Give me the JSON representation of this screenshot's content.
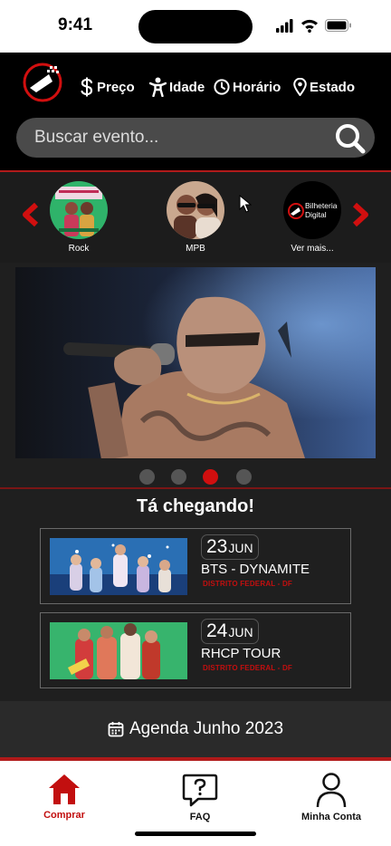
{
  "status_bar": {
    "time": "9:41"
  },
  "filters": [
    {
      "label": "Preço",
      "icon": "dollar-icon"
    },
    {
      "label": "Idade",
      "icon": "person-icon"
    },
    {
      "label": "Horário",
      "icon": "clock-icon"
    },
    {
      "label": "Estado",
      "icon": "location-pin-icon"
    }
  ],
  "search": {
    "placeholder": "Buscar evento..."
  },
  "categories": [
    {
      "label": "Rock"
    },
    {
      "label": "MPB"
    },
    {
      "label": "Ver mais...",
      "logo_text": "Bilheteria Digital"
    }
  ],
  "carousel": {
    "total": 4,
    "active_index": 2
  },
  "section": {
    "heading": "Tá chegando!"
  },
  "events": [
    {
      "day": "23",
      "month": "JUN",
      "title": "BTS - DYNAMITE",
      "location": "DISTRITO FEDERAL - DF"
    },
    {
      "day": "24",
      "month": "JUN",
      "title": "RHCP TOUR",
      "location": "DISTRITO FEDERAL - DF"
    }
  ],
  "agenda": {
    "label": "Agenda Junho 2023"
  },
  "tabs": [
    {
      "label": "Comprar",
      "icon": "home-icon",
      "active": true
    },
    {
      "label": "FAQ",
      "icon": "faq-icon",
      "active": false
    },
    {
      "label": "Minha Conta",
      "icon": "user-icon",
      "active": false
    }
  ],
  "colors": {
    "accent": "#d10f0f",
    "background": "#1f1f1f",
    "header": "#000000"
  }
}
